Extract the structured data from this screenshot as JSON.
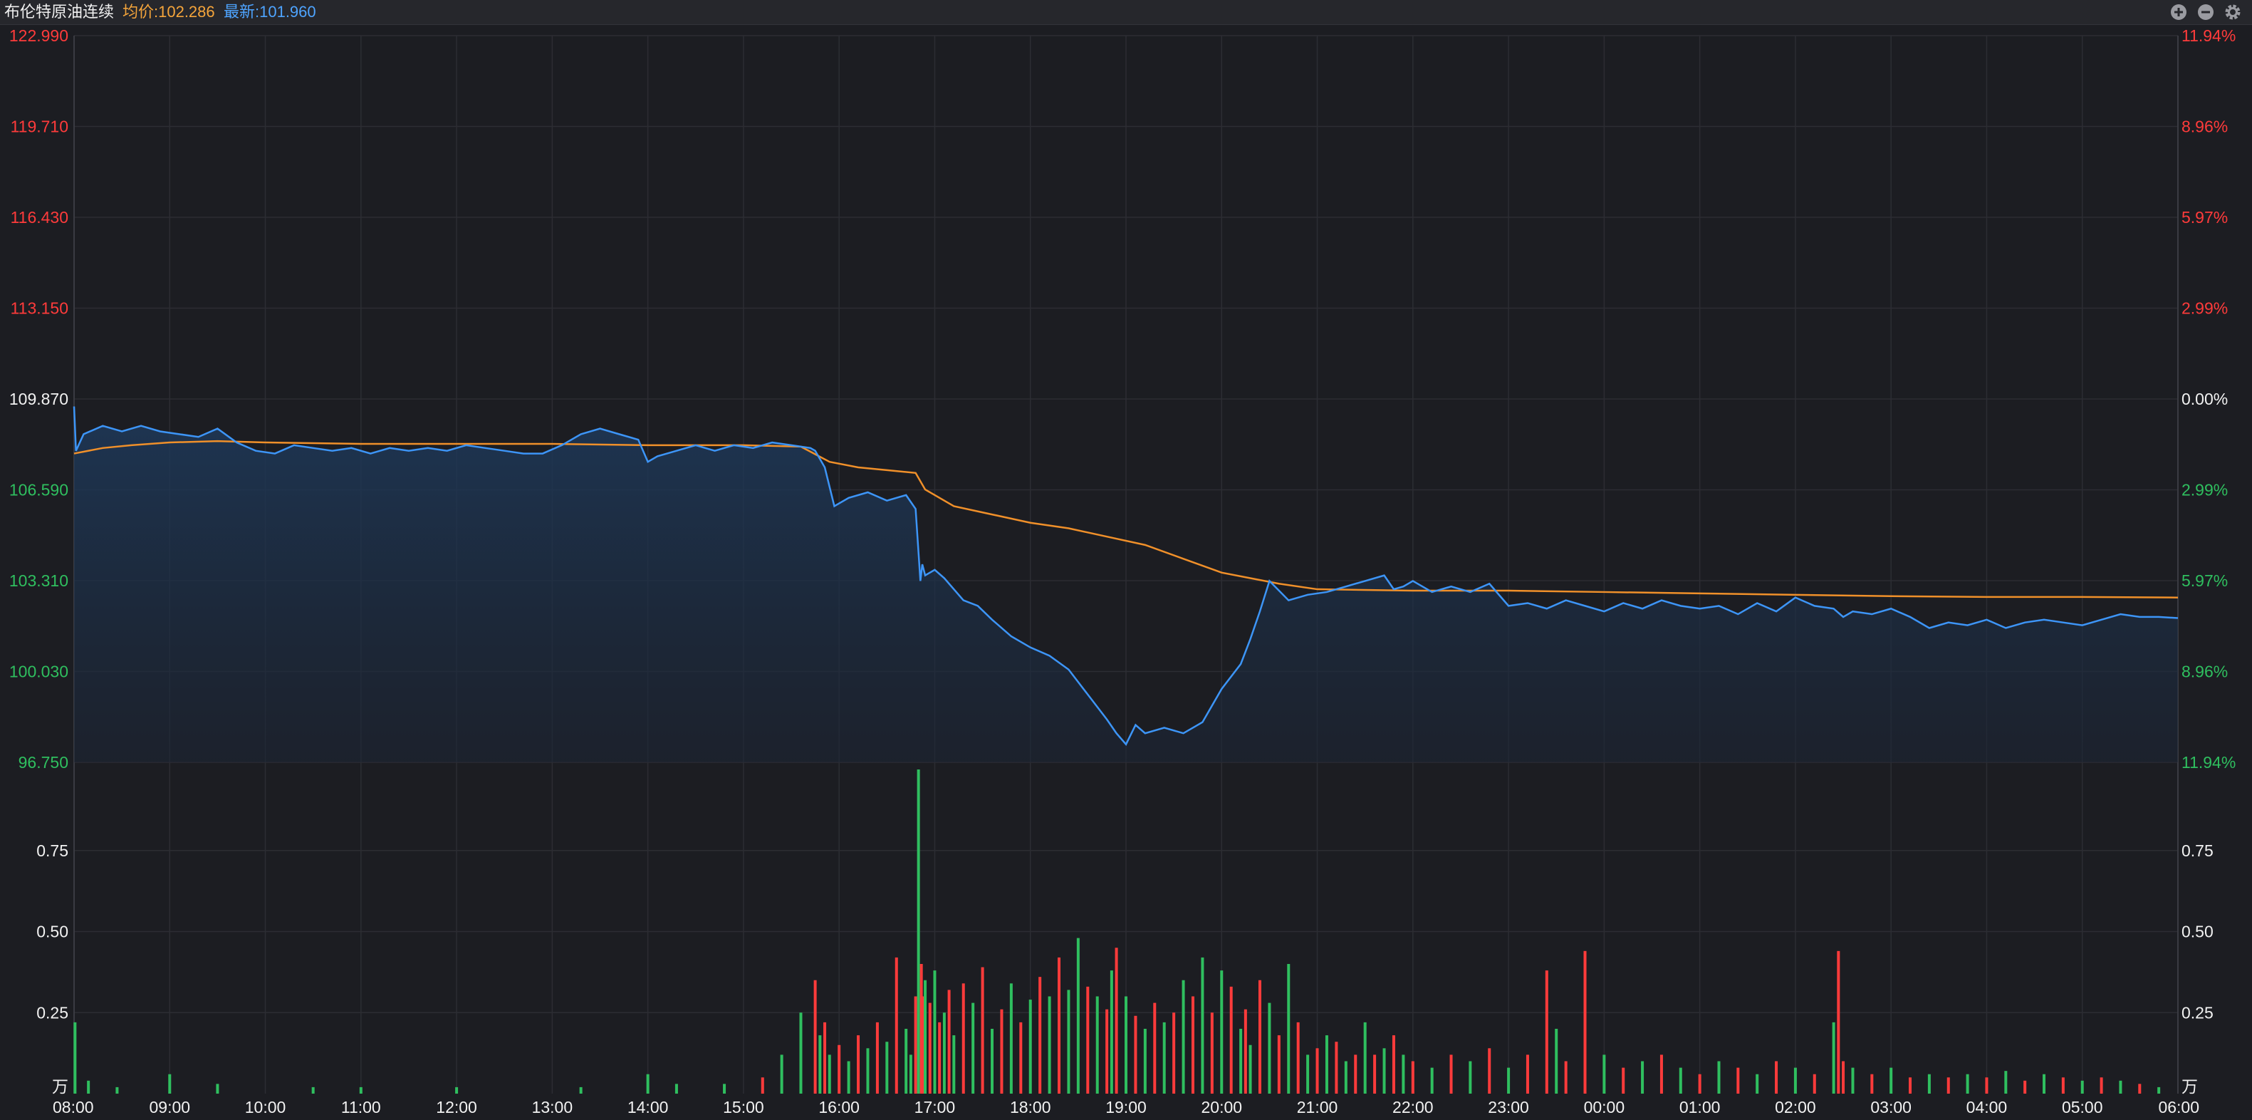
{
  "header": {
    "title": "布伦特原油连续",
    "avg_label": "均价:102.286",
    "last_label": "最新:101.960",
    "icons": [
      "zoom-in-icon",
      "zoom-out-icon",
      "gear-icon"
    ]
  },
  "colors": {
    "background": "#1c1d22",
    "price_line": "#3d95f7",
    "avg_line": "#f0902a",
    "up": "#ff3b3b",
    "down": "#2fbf5f",
    "neutral": "#f2f2f2",
    "grid": "#2c2d33"
  },
  "chart_data": [
    {
      "type": "line",
      "x_ticks": [
        "08:00",
        "09:00",
        "10:00",
        "11:00",
        "12:00",
        "13:00",
        "14:00",
        "15:00",
        "16:00",
        "17:00",
        "18:00",
        "19:00",
        "20:00",
        "21:00",
        "22:00",
        "23:00",
        "00:00",
        "01:00",
        "02:00",
        "03:00",
        "04:00",
        "05:00",
        "06:00"
      ],
      "y_ticks_left": [
        "122.990",
        "119.710",
        "116.430",
        "113.150",
        "109.870",
        "106.590",
        "103.310",
        "100.030",
        "96.750"
      ],
      "y_ticks_right": [
        "11.94%",
        "8.96%",
        "5.97%",
        "2.99%",
        "0.00%",
        "2.99%",
        "5.97%",
        "8.96%",
        "11.94%"
      ],
      "ylim": [
        96.75,
        122.99
      ],
      "reference_price": 109.87,
      "series": [
        {
          "key": "price",
          "x_hours": [
            0,
            0.02,
            0.1,
            0.3,
            0.5,
            0.7,
            0.9,
            1.1,
            1.3,
            1.5,
            1.7,
            1.9,
            2.1,
            2.3,
            2.5,
            2.7,
            2.9,
            3.1,
            3.3,
            3.5,
            3.7,
            3.9,
            4.1,
            4.3,
            4.5,
            4.7,
            4.9,
            5.1,
            5.3,
            5.5,
            5.7,
            5.9,
            6.0,
            6.1,
            6.3,
            6.5,
            6.7,
            6.9,
            7.1,
            7.3,
            7.5,
            7.7,
            7.75,
            7.85,
            7.95,
            8.1,
            8.3,
            8.5,
            8.7,
            8.8,
            8.85,
            8.87,
            8.9,
            9.0,
            9.1,
            9.3,
            9.45,
            9.6,
            9.8,
            10.0,
            10.2,
            10.4,
            10.6,
            10.8,
            10.9,
            11.0,
            11.1,
            11.2,
            11.4,
            11.6,
            11.8,
            12.0,
            12.2,
            12.3,
            12.4,
            12.5,
            12.7,
            12.9,
            13.1,
            13.3,
            13.5,
            13.7,
            13.8,
            13.9,
            14.0,
            14.2,
            14.4,
            14.6,
            14.8,
            15.0,
            15.2,
            15.4,
            15.6,
            15.8,
            16.0,
            16.2,
            16.4,
            16.6,
            16.8,
            17.0,
            17.2,
            17.4,
            17.6,
            17.8,
            18.0,
            18.2,
            18.4,
            18.5,
            18.6,
            18.8,
            19.0,
            19.2,
            19.4,
            19.6,
            19.8,
            20.0,
            20.2,
            20.4,
            20.6,
            20.8,
            21.0,
            21.2,
            21.4,
            21.6,
            21.8,
            22.0
          ],
          "values": [
            109.6,
            108.0,
            108.6,
            108.9,
            108.7,
            108.9,
            108.7,
            108.6,
            108.5,
            108.8,
            108.3,
            108.0,
            107.9,
            108.2,
            108.1,
            108.0,
            108.1,
            107.9,
            108.1,
            108.0,
            108.1,
            108.0,
            108.2,
            108.1,
            108.0,
            107.9,
            107.9,
            108.2,
            108.6,
            108.8,
            108.6,
            108.4,
            107.6,
            107.8,
            108.0,
            108.2,
            108.0,
            108.2,
            108.1,
            108.3,
            108.2,
            108.1,
            108.0,
            107.4,
            106.0,
            106.3,
            106.5,
            106.2,
            106.4,
            105.9,
            103.3,
            103.9,
            103.5,
            103.7,
            103.4,
            102.6,
            102.4,
            101.9,
            101.3,
            100.9,
            100.6,
            100.1,
            99.2,
            98.3,
            97.8,
            97.4,
            98.1,
            97.8,
            98.0,
            97.8,
            98.2,
            99.4,
            100.3,
            101.2,
            102.2,
            103.3,
            102.6,
            102.8,
            102.9,
            103.1,
            103.3,
            103.5,
            103.0,
            103.1,
            103.3,
            102.9,
            103.1,
            102.9,
            103.2,
            102.4,
            102.5,
            102.3,
            102.6,
            102.4,
            102.2,
            102.5,
            102.3,
            102.6,
            102.4,
            102.3,
            102.4,
            102.1,
            102.5,
            102.2,
            102.7,
            102.4,
            102.3,
            102.0,
            102.2,
            102.1,
            102.3,
            102.0,
            101.6,
            101.8,
            101.7,
            101.9,
            101.6,
            101.8,
            101.9,
            101.8,
            101.7,
            101.9,
            102.1,
            102.0,
            102.0,
            101.96
          ]
        },
        {
          "key": "average",
          "x_hours": [
            0,
            0.3,
            0.6,
            1.0,
            1.5,
            2.0,
            3.0,
            4.0,
            5.0,
            6.0,
            7.0,
            7.6,
            7.9,
            8.2,
            8.5,
            8.8,
            8.9,
            9.2,
            9.6,
            10.0,
            10.4,
            10.8,
            11.2,
            11.6,
            12.0,
            12.3,
            12.6,
            13.0,
            14.0,
            15.0,
            16.0,
            17.0,
            18.0,
            19.0,
            20.0,
            21.0,
            22.0
          ],
          "values": [
            107.9,
            108.1,
            108.2,
            108.3,
            108.35,
            108.3,
            108.25,
            108.25,
            108.25,
            108.2,
            108.2,
            108.15,
            107.6,
            107.4,
            107.3,
            107.2,
            106.6,
            106.0,
            105.7,
            105.4,
            105.2,
            104.9,
            104.6,
            104.1,
            103.6,
            103.4,
            103.2,
            103.0,
            102.95,
            102.95,
            102.9,
            102.85,
            102.8,
            102.75,
            102.72,
            102.72,
            102.7
          ]
        }
      ]
    },
    {
      "type": "bar",
      "title": "万",
      "y_ticks": [
        "0.75",
        "0.50",
        "0.25"
      ],
      "ylim": [
        0,
        1.0
      ],
      "x_hours": [
        0.01,
        0.15,
        0.45,
        1.0,
        1.5,
        2.5,
        3.0,
        4.0,
        5.3,
        6.0,
        6.3,
        6.8,
        7.2,
        7.4,
        7.6,
        7.75,
        7.8,
        7.85,
        7.9,
        8.0,
        8.1,
        8.2,
        8.3,
        8.4,
        8.5,
        8.6,
        8.7,
        8.75,
        8.8,
        8.83,
        8.86,
        8.88,
        8.9,
        8.95,
        9.0,
        9.05,
        9.1,
        9.15,
        9.2,
        9.3,
        9.4,
        9.5,
        9.6,
        9.7,
        9.8,
        9.9,
        10.0,
        10.1,
        10.2,
        10.3,
        10.4,
        10.5,
        10.6,
        10.7,
        10.8,
        10.85,
        10.9,
        11.0,
        11.1,
        11.2,
        11.3,
        11.4,
        11.5,
        11.6,
        11.7,
        11.8,
        11.9,
        12.0,
        12.1,
        12.2,
        12.25,
        12.3,
        12.4,
        12.5,
        12.6,
        12.7,
        12.8,
        12.9,
        13.0,
        13.1,
        13.2,
        13.3,
        13.4,
        13.5,
        13.6,
        13.7,
        13.8,
        13.9,
        14.0,
        14.2,
        14.4,
        14.6,
        14.8,
        15.0,
        15.2,
        15.4,
        15.5,
        15.6,
        15.8,
        16.0,
        16.2,
        16.4,
        16.6,
        16.8,
        17.0,
        17.2,
        17.4,
        17.6,
        17.8,
        18.0,
        18.2,
        18.4,
        18.45,
        18.5,
        18.6,
        18.8,
        19.0,
        19.2,
        19.4,
        19.6,
        19.8,
        20.0,
        20.2,
        20.4,
        20.6,
        20.8,
        21.0,
        21.2,
        21.4,
        21.6,
        21.8
      ],
      "values": [
        0.22,
        0.04,
        0.02,
        0.06,
        0.03,
        0.02,
        0.02,
        0.02,
        0.02,
        0.06,
        0.03,
        0.03,
        0.05,
        0.12,
        0.25,
        0.35,
        0.18,
        0.22,
        0.12,
        0.15,
        0.1,
        0.18,
        0.14,
        0.22,
        0.16,
        0.42,
        0.2,
        0.12,
        0.3,
        1.0,
        0.4,
        0.3,
        0.35,
        0.28,
        0.38,
        0.22,
        0.25,
        0.32,
        0.18,
        0.34,
        0.28,
        0.39,
        0.2,
        0.26,
        0.34,
        0.22,
        0.29,
        0.36,
        0.3,
        0.42,
        0.32,
        0.48,
        0.33,
        0.3,
        0.26,
        0.38,
        0.45,
        0.3,
        0.24,
        0.2,
        0.28,
        0.22,
        0.25,
        0.35,
        0.3,
        0.42,
        0.25,
        0.38,
        0.33,
        0.2,
        0.26,
        0.15,
        0.35,
        0.28,
        0.18,
        0.4,
        0.22,
        0.12,
        0.14,
        0.18,
        0.16,
        0.1,
        0.12,
        0.22,
        0.12,
        0.14,
        0.18,
        0.12,
        0.1,
        0.08,
        0.12,
        0.1,
        0.14,
        0.08,
        0.12,
        0.38,
        0.2,
        0.1,
        0.44,
        0.12,
        0.08,
        0.1,
        0.12,
        0.08,
        0.06,
        0.1,
        0.08,
        0.06,
        0.1,
        0.08,
        0.06,
        0.22,
        0.44,
        0.1,
        0.08,
        0.06,
        0.08,
        0.05,
        0.06,
        0.05,
        0.06,
        0.05,
        0.07,
        0.04,
        0.06,
        0.05,
        0.04,
        0.05,
        0.04,
        0.03,
        0.02
      ],
      "directions": [
        "down",
        "down",
        "down",
        "down",
        "down",
        "down",
        "down",
        "down",
        "down",
        "down",
        "down",
        "down",
        "up",
        "down",
        "down",
        "up",
        "down",
        "up",
        "down",
        "up",
        "down",
        "up",
        "down",
        "up",
        "down",
        "up",
        "down",
        "down",
        "up",
        "down",
        "up",
        "up",
        "down",
        "up",
        "down",
        "up",
        "down",
        "up",
        "down",
        "up",
        "down",
        "up",
        "down",
        "up",
        "down",
        "up",
        "down",
        "up",
        "down",
        "up",
        "down",
        "down",
        "up",
        "down",
        "up",
        "down",
        "up",
        "down",
        "up",
        "down",
        "up",
        "down",
        "up",
        "down",
        "up",
        "down",
        "up",
        "down",
        "up",
        "down",
        "up",
        "down",
        "up",
        "down",
        "up",
        "down",
        "up",
        "down",
        "up",
        "down",
        "up",
        "down",
        "up",
        "down",
        "up",
        "down",
        "up",
        "down",
        "up",
        "down",
        "up",
        "down",
        "up",
        "down",
        "up",
        "up",
        "down",
        "up",
        "up",
        "down",
        "up",
        "down",
        "up",
        "down",
        "up",
        "down",
        "up",
        "down",
        "up",
        "down",
        "up",
        "down",
        "up",
        "up",
        "down",
        "up",
        "down",
        "up",
        "down",
        "up",
        "down",
        "up",
        "down",
        "up",
        "down",
        "up",
        "down",
        "up",
        "down",
        "up"
      ]
    }
  ]
}
